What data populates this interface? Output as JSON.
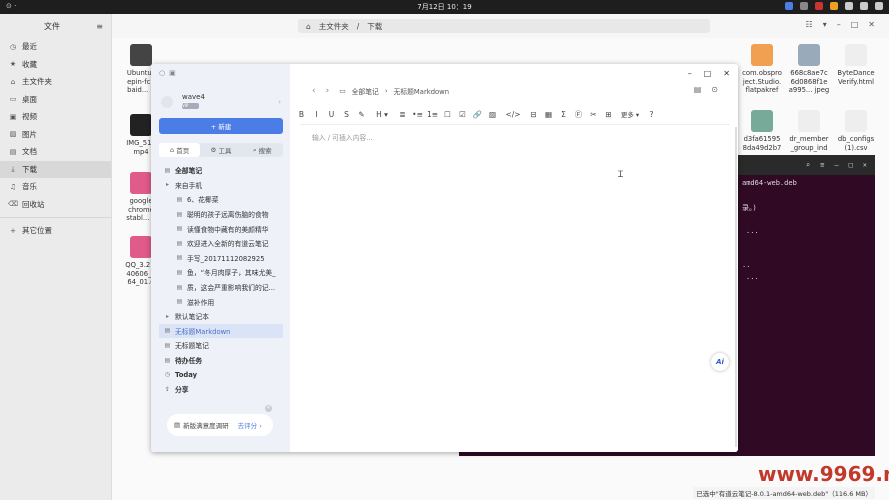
{
  "topbar": {
    "clock": "7月12日  10：19",
    "activities": "⊙ ·",
    "tray_colors": [
      "#4a7de6",
      "#888888",
      "#cc3333",
      "#f0a020",
      "#cccccc",
      "#cccccc",
      "#cccccc"
    ]
  },
  "files": {
    "title": "文件",
    "sidebar": [
      {
        "icon": "◷",
        "label": "最近"
      },
      {
        "icon": "★",
        "label": "收藏"
      },
      {
        "icon": "⌂",
        "label": "主文件夹"
      },
      {
        "icon": "▭",
        "label": "桌面"
      },
      {
        "icon": "▣",
        "label": "视频"
      },
      {
        "icon": "▨",
        "label": "图片"
      },
      {
        "icon": "▤",
        "label": "文档"
      },
      {
        "icon": "⤓",
        "label": "下载"
      },
      {
        "icon": "♫",
        "label": "音乐"
      },
      {
        "icon": "⌫",
        "label": "回收站"
      },
      {
        "icon": "+",
        "label": "其它位置"
      }
    ],
    "path": [
      "主文件夹",
      "/",
      "下载"
    ]
  },
  "desktop_files": [
    {
      "label": "Ubuntu_\nepin-fcit\nbaid... n",
      "color": "#444"
    },
    {
      "label": "IMG_515\nmp4",
      "color": "#222"
    },
    {
      "label": "google\nchrome\nstabl... e",
      "color": "#e05a8a"
    },
    {
      "label": "QQ_3.2.9\n40606_a\n64_01.d",
      "color": "#e05a8a"
    },
    {
      "label": "com.obspro\nject.Studio.\nflatpakref",
      "color": "#f0a050"
    },
    {
      "label": "668c8ae7c\n6d0868f1e\na995... jpeg",
      "color": "#9ab"
    },
    {
      "label": "ByteDance\nVerify.html",
      "color": "#eee"
    },
    {
      "label": "d3fa61595\n8da49d2b7",
      "color": "#7a9"
    },
    {
      "label": "dr_member\n_group_ind",
      "color": "#eee"
    },
    {
      "label": "db_configs\n(1).csv",
      "color": "#eee"
    }
  ],
  "terminal": {
    "lines": [
      "amd64-web.deb",
      "录。)",
      "...",
      "..",
      "..."
    ],
    "buttons": [
      "⌕",
      "≡",
      "–",
      "□",
      "✕"
    ]
  },
  "statusbar": "已选中\"有道云笔记-8.0.1-amd64-web.deb\"（116.6 MB）",
  "watermark": "www.9969.net",
  "ynote": {
    "user": {
      "name": "wave4",
      "badge": "VIP"
    },
    "new_button": "+ 新建",
    "tabs": [
      "首页",
      "工具",
      "搜索"
    ],
    "tree": [
      {
        "icon": "▤",
        "label": "全部笔记",
        "bold": true,
        "indent": 0
      },
      {
        "icon": "▸",
        "label": "来自手机",
        "indent": 0
      },
      {
        "icon": "▤",
        "label": "6、花椰菜",
        "indent": 1
      },
      {
        "icon": "▤",
        "label": "聪明的孩子远离伤脑的食物",
        "indent": 1
      },
      {
        "icon": "▤",
        "label": "读懂食物中藏有的美颜精华",
        "indent": 1
      },
      {
        "icon": "▤",
        "label": "欢迎进入全新的有道云笔记",
        "indent": 1
      },
      {
        "icon": "▤",
        "label": "手写_20171112082925",
        "indent": 1
      },
      {
        "icon": "▤",
        "label": "鱼，“冬月肉厚子，其味尤美_",
        "indent": 1
      },
      {
        "icon": "▤",
        "label": "质，这会严重影响我们的记...",
        "indent": 1
      },
      {
        "icon": "▤",
        "label": "滋补作用",
        "indent": 1
      },
      {
        "icon": "▸",
        "label": "默认笔记本",
        "indent": 0
      },
      {
        "icon": "▤",
        "label": "无标题Markdown",
        "indent": 0,
        "selected": true
      },
      {
        "icon": "▤",
        "label": "无标题笔记",
        "indent": 0
      },
      {
        "icon": "▤",
        "label": "待办任务",
        "bold": true,
        "indent": 0
      },
      {
        "icon": "◷",
        "label": "Today",
        "bold": true,
        "indent": 0
      },
      {
        "icon": "⇪",
        "label": "分享",
        "bold": true,
        "indent": 0
      }
    ],
    "survey": {
      "label": "新版满意度调研",
      "link": "去评分 ›"
    },
    "editor": {
      "breadcrumb_root": "全部笔记",
      "breadcrumb_sep": "›",
      "breadcrumb_current": "无标题Markdown",
      "placeholder": "输入 / 可插入内容...",
      "more_label": "更多 ▾",
      "ai_label": "Ai",
      "toolbar": [
        "B",
        "I",
        "U",
        "S",
        "✎",
        "H ▾",
        "≣",
        "•≡",
        "1≡",
        "☐",
        "☑",
        "🔗",
        "▨",
        "</>",
        "⊟",
        "▦",
        "Σ",
        "Ⓕ",
        "✂",
        "⊞"
      ]
    }
  }
}
